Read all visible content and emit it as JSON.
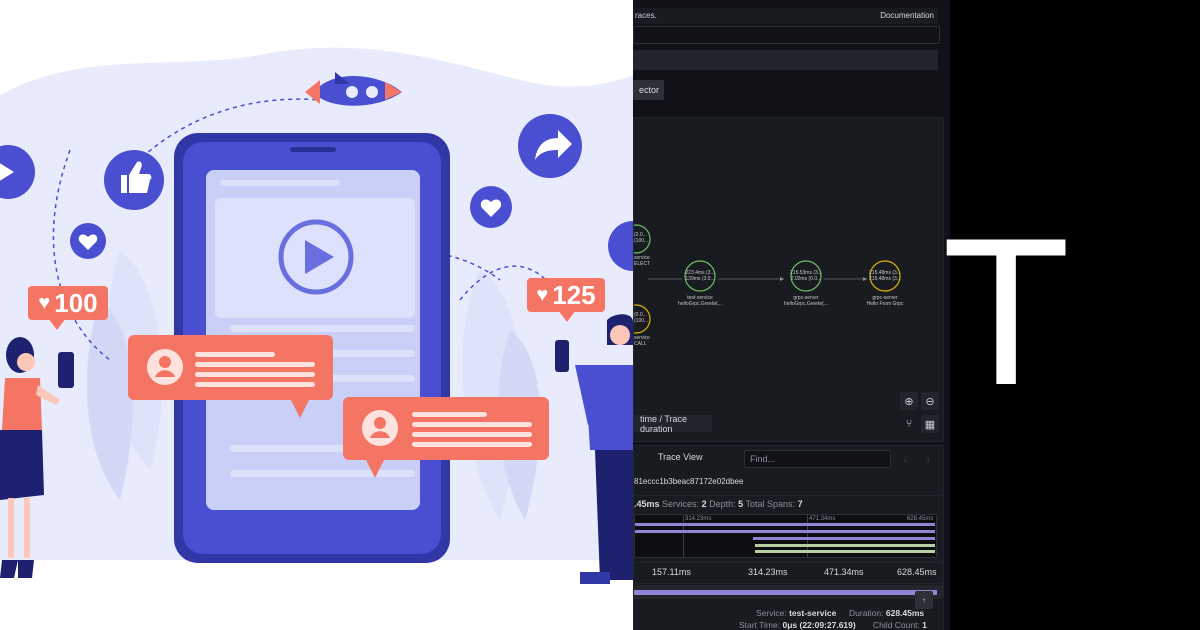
{
  "illustration": {
    "likes_left": "100",
    "likes_right": "125",
    "colors": {
      "primary": "#4a4fd1",
      "accent": "#f47564",
      "background": "#e8ebfb"
    }
  },
  "trace_panel": {
    "header_text": "races.",
    "documentation_link": "Documentation",
    "selector_button": "ector",
    "timing_button": "time / Trace duration",
    "trace_view_title": "Trace View",
    "find_placeholder": "Find...",
    "trace_id": "81eccc1b3beac87172e02dbee",
    "summary": {
      "duration": ".45ms",
      "services_label": "Services:",
      "services_value": "2",
      "depth_label": "Depth:",
      "depth_value": "5",
      "spans_label": "Total Spans:",
      "spans_value": "7"
    },
    "minimap_ticks": [
      "314.23ms",
      "471.34ms",
      "628.45ms"
    ],
    "ruler_ticks": [
      "157.11ms",
      "314.23ms",
      "471.34ms",
      "628.45ms"
    ],
    "span_detail": {
      "service_label": "Service:",
      "service_value": "test-service",
      "duration_label": "Duration:",
      "duration_value": "628.45ms",
      "start_label": "Start Time:",
      "start_value": "0μs (22:09:27.619)",
      "child_label": "Child Count:",
      "child_value": "1"
    },
    "graph_nodes": [
      {
        "stats": [
          "(0.0...",
          "(100..."
        ],
        "service": "service",
        "op": "ELECT"
      },
      {
        "stats": [
          "(0.0...",
          "(100..."
        ],
        "service": "service",
        "op": "CALL"
      },
      {
        "stats": [
          "223.4ms (3...",
          "139ms (3.0..."
        ],
        "service": "test-service",
        "op": "helloGrpc.Greete(..."
      },
      {
        "stats": [
          "215.53ms (3...",
          "2.02ms (0.0..."
        ],
        "service": "grpc-server",
        "op": "helloGrpc.Greete(..."
      },
      {
        "stats": [
          "215.48ms (3...",
          "215.48ms (3..."
        ],
        "service": "grpc-server",
        "op": "Hello From Grpc"
      }
    ],
    "colors": {
      "background": "#111217",
      "panel": "#181b1f",
      "node_ring": "#73bf69",
      "node_ring_alt": "#e0b400",
      "span_bar": "#8f84d6",
      "span_bar_green": "#b7cfa0"
    }
  },
  "right_strip": {
    "glyph": "T"
  }
}
